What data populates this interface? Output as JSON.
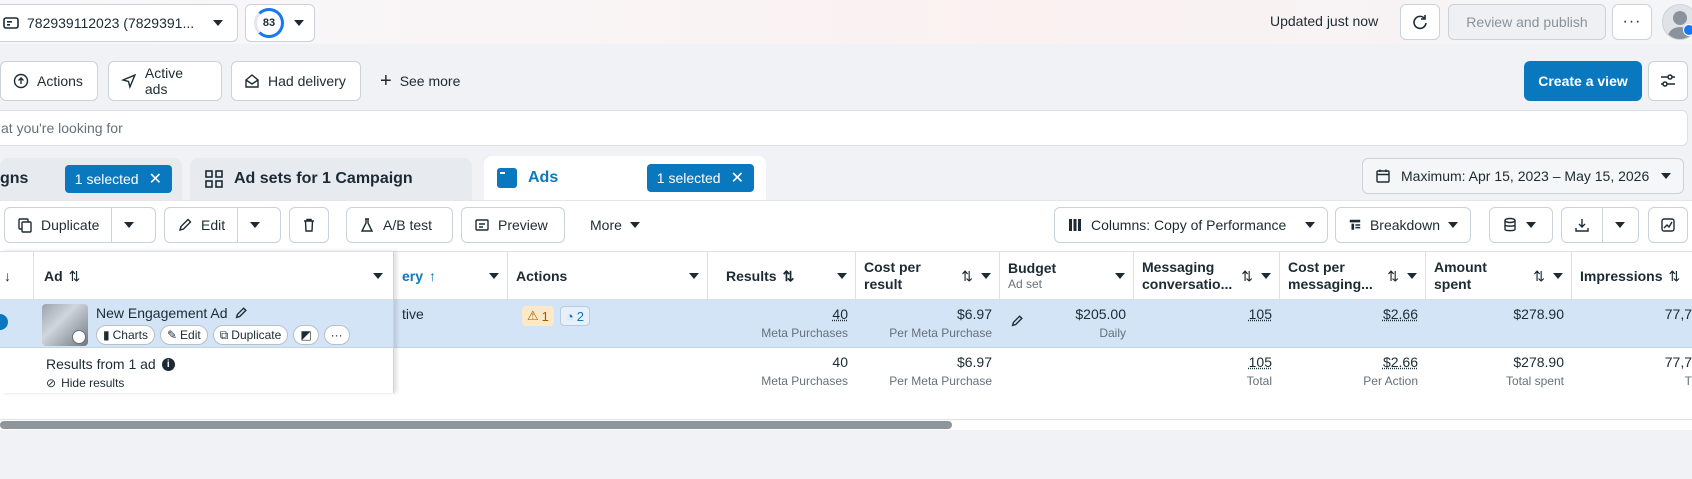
{
  "topbar": {
    "account_label": "782939112023 (7829391...",
    "score": "83",
    "updated": "Updated just now",
    "review_publish": "Review and publish"
  },
  "filters": {
    "items": [
      "Actions",
      "Active ads",
      "Had delivery"
    ],
    "see_more": "See more",
    "create_view": "Create a view"
  },
  "search": {
    "placeholder": "at you're looking for"
  },
  "tabs": {
    "campaigns_partial": "gns",
    "campaigns_selected": "1 selected",
    "adsets": "Ad sets for 1 Campaign",
    "ads": "Ads",
    "ads_selected": "1 selected"
  },
  "date_range": "Maximum: Apr 15, 2023 – May 15, 2026",
  "toolbar": {
    "duplicate": "Duplicate",
    "edit": "Edit",
    "ab_test": "A/B test",
    "preview": "Preview",
    "more": "More",
    "columns": "Columns: Copy of Performance",
    "breakdown": "Breakdown"
  },
  "headers": {
    "ad": "Ad",
    "delivery": "ery",
    "actions": "Actions",
    "results": "Results",
    "cost_per_result_1": "Cost per",
    "cost_per_result_2": "result",
    "budget": "Budget",
    "budget_sub": "Ad set",
    "messaging_1": "Messaging",
    "messaging_2": "conversatio...",
    "cost_msg_1": "Cost per",
    "cost_msg_2": "messaging...",
    "amount_1": "Amount",
    "amount_2": "spent",
    "impressions": "Impressions"
  },
  "row": {
    "ad_name": "New Engagement Ad",
    "charts": "Charts",
    "edit": "Edit",
    "duplicate": "Duplicate",
    "delivery": "tive",
    "warn_count": "1",
    "rec_count": "2",
    "results": "40",
    "results_sub": "Meta Purchases",
    "cpr": "$6.97",
    "cpr_sub": "Per Meta Purchase",
    "budget": "$205.00",
    "budget_sub": "Daily",
    "messaging": "105",
    "cost_msg": "$2.66",
    "amount": "$278.90",
    "impressions": "77,7"
  },
  "summary": {
    "label": "Results from 1 ad",
    "hide": "Hide results",
    "results": "40",
    "results_sub": "Meta Purchases",
    "cpr": "$6.97",
    "cpr_sub": "Per Meta Purchase",
    "messaging": "105",
    "messaging_sub": "Total",
    "cost_msg": "$2.66",
    "cost_msg_sub": "Per Action",
    "amount": "$278.90",
    "amount_sub": "Total spent",
    "impressions": "77,7",
    "impressions_sub": "T"
  }
}
